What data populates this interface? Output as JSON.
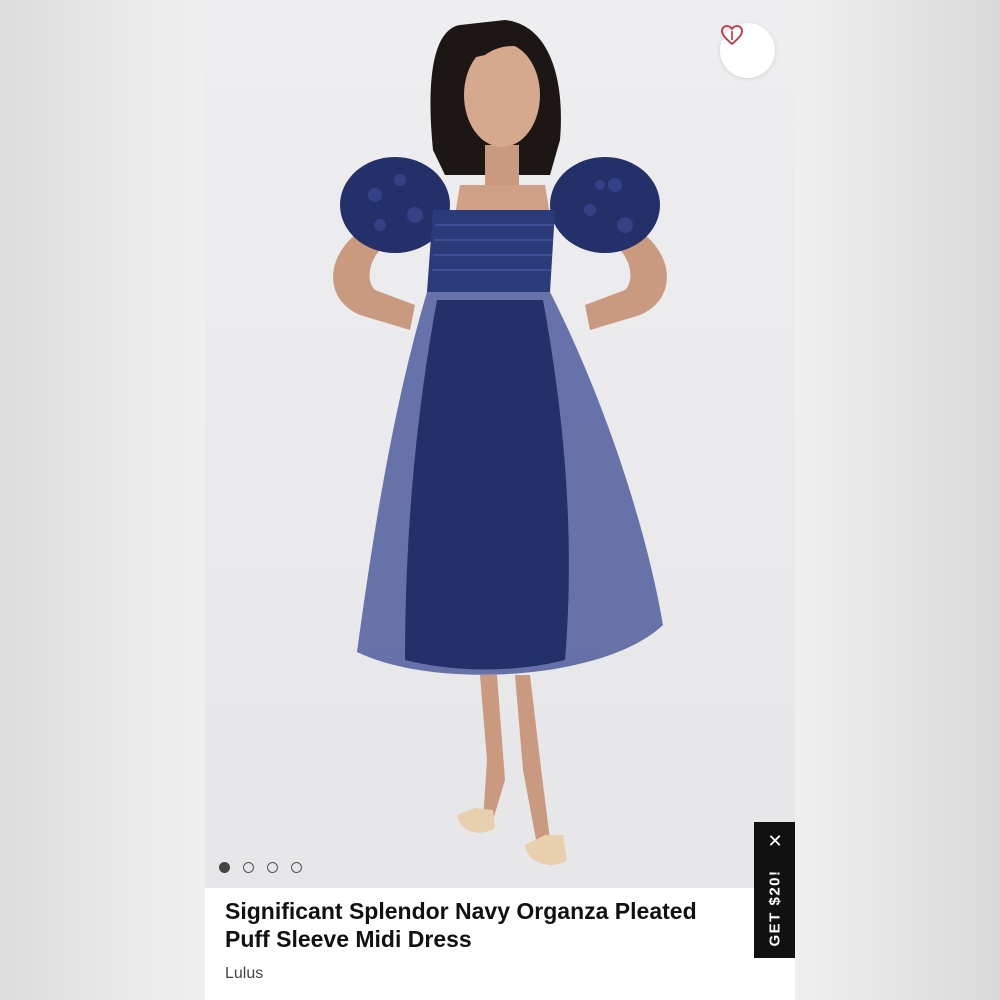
{
  "product": {
    "title": "Significant Splendor Navy Organza Pleated Puff Sleeve Midi Dress",
    "brand": "Lulus",
    "image_alt": "Model wearing a navy organza puff sleeve midi dress"
  },
  "gallery": {
    "total_images": 4,
    "active_index": 0
  },
  "favorite": {
    "icon": "heart-icon",
    "color": "#c8323c"
  },
  "promo": {
    "label": "GET $20!",
    "close_icon": "close-icon",
    "bg_color": "#111111"
  },
  "colors": {
    "dress": "#2b3a78",
    "page_bg": "#ffffff"
  }
}
